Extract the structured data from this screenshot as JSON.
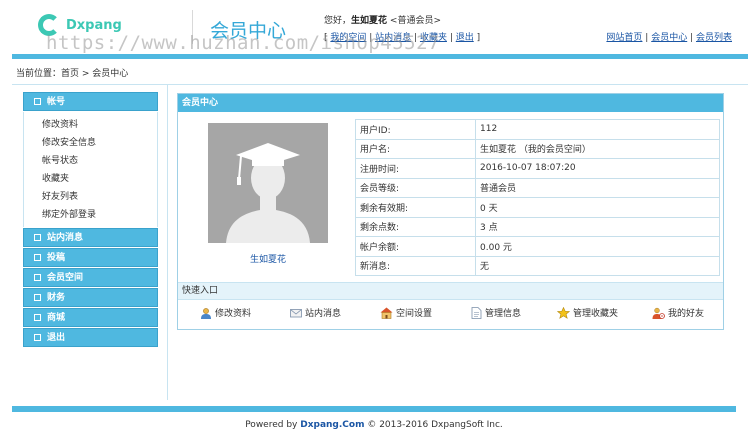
{
  "header": {
    "logo_text": "Dxpang",
    "title": "会员中心",
    "greeting_prefix": "您好，",
    "username": "生如夏花",
    "member_level": "<普通会员>",
    "user_links": [
      "我的空间",
      "站内消息",
      "收藏夹",
      "退出"
    ],
    "top_links": [
      "网站首页",
      "会员中心",
      "会员列表"
    ],
    "watermark": "https://www.huzhan.com/ishop45527"
  },
  "breadcrumb": {
    "prefix": "当前位置：",
    "home": "首页",
    "sep": " > ",
    "current": "会员中心"
  },
  "sidebar": {
    "sections": [
      {
        "label": "帐号",
        "items": [
          "修改资料",
          "修改安全信息",
          "帐号状态",
          "收藏夹",
          "好友列表",
          "绑定外部登录"
        ]
      },
      {
        "label": "站内消息",
        "items": []
      },
      {
        "label": "投稿",
        "items": []
      },
      {
        "label": "会员空间",
        "items": []
      },
      {
        "label": "财务",
        "items": []
      },
      {
        "label": "商城",
        "items": []
      },
      {
        "label": "退出",
        "items": []
      }
    ]
  },
  "panel": {
    "title": "会员中心",
    "avatar_name": "生如夏花",
    "info": [
      {
        "key": "用户ID:",
        "value": "112"
      },
      {
        "key": "用户名:",
        "value": "生如夏花  （我的会员空间）"
      },
      {
        "key": "注册时间:",
        "value": "2016-10-07 18:07:20"
      },
      {
        "key": "会员等级:",
        "value": "普通会员"
      },
      {
        "key": "剩余有效期:",
        "value": "0 天"
      },
      {
        "key": "剩余点数:",
        "value": "3 点"
      },
      {
        "key": "帐户余额:",
        "value": "0.00 元"
      },
      {
        "key": "新消息:",
        "value": "无"
      }
    ],
    "quick_title": "快速入口",
    "quick_items": [
      "修改资料",
      "站内消息",
      "空间设置",
      "管理信息",
      "管理收藏夹",
      "我的好友"
    ]
  },
  "footer": {
    "prefix": "Powered by ",
    "brand": "Dxpang.Com",
    "suffix": " © 2013-2016 DxpangSoft Inc."
  },
  "colors": {
    "accent": "#4fb8e0",
    "link": "#1a55a4",
    "title": "#35a8d7"
  }
}
